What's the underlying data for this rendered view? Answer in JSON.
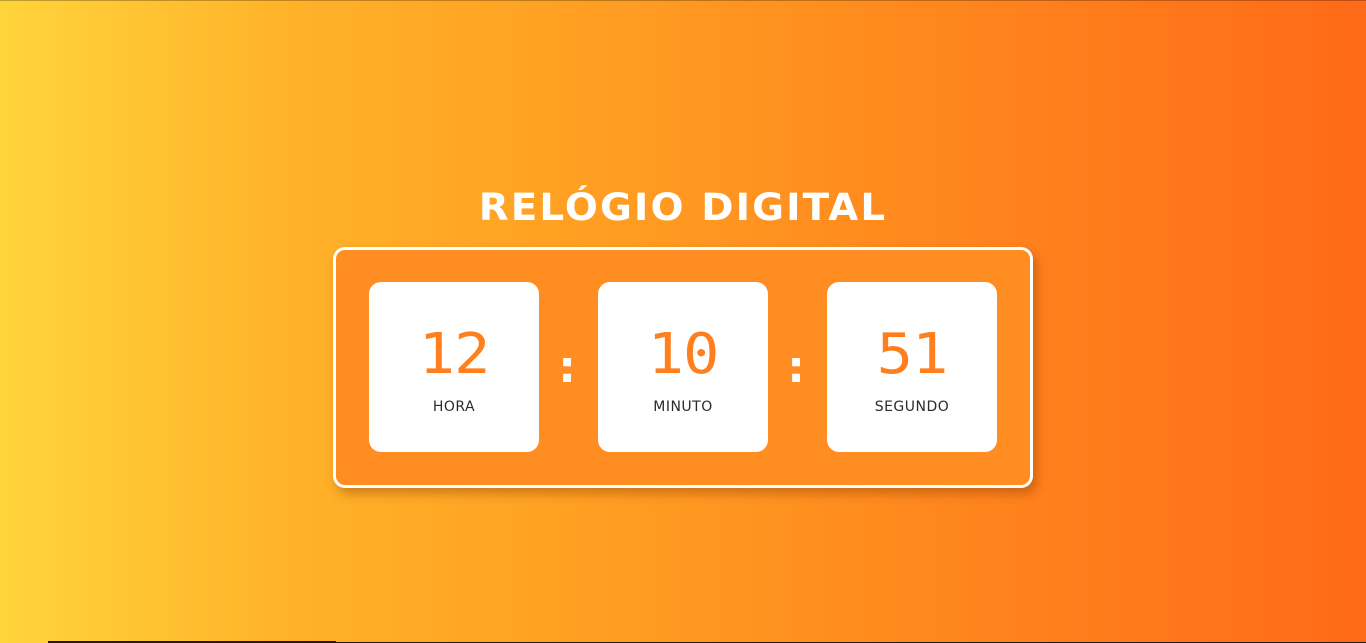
{
  "page": {
    "title": "RELÓGIO DIGITAL"
  },
  "clock": {
    "hours": {
      "value": "12",
      "label": "HORA"
    },
    "minutes": {
      "value": "10",
      "label": "MINUTO"
    },
    "seconds": {
      "value": "51",
      "label": "SEGUNDO"
    },
    "separator": ":"
  },
  "colors": {
    "gradient_start": "#ffd43b",
    "gradient_end": "#ff6a18",
    "digit_color": "#ff7f1f",
    "box_background": "#ffffff",
    "label_color": "#2a2a2a"
  }
}
